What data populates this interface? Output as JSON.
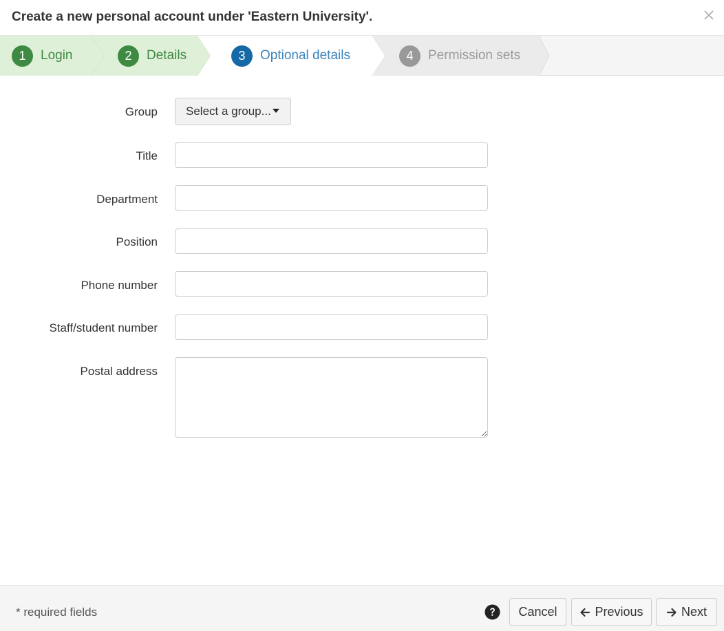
{
  "header": {
    "title": "Create a new personal account under 'Eastern University'."
  },
  "steps": [
    {
      "number": "1",
      "label": "Login",
      "state": "done"
    },
    {
      "number": "2",
      "label": "Details",
      "state": "done"
    },
    {
      "number": "3",
      "label": "Optional details",
      "state": "active"
    },
    {
      "number": "4",
      "label": "Permission sets",
      "state": "todo"
    }
  ],
  "form": {
    "group": {
      "label": "Group",
      "button": "Select a group..."
    },
    "title": {
      "label": "Title",
      "value": ""
    },
    "department": {
      "label": "Department",
      "value": ""
    },
    "position": {
      "label": "Position",
      "value": ""
    },
    "phone": {
      "label": "Phone number",
      "value": ""
    },
    "staff_number": {
      "label": "Staff/student number",
      "value": ""
    },
    "postal_address": {
      "label": "Postal address",
      "value": ""
    }
  },
  "footer": {
    "required_note": "* required fields",
    "cancel": "Cancel",
    "previous": "Previous",
    "next": "Next"
  },
  "colors": {
    "done": "#3e8a43",
    "done_bg": "#dff0d8",
    "active": "#1569a6",
    "todo": "#999999"
  },
  "icons": {
    "close": "close-icon",
    "help": "question-circle-icon",
    "previous": "arrow-left-icon",
    "next": "arrow-right-icon"
  }
}
